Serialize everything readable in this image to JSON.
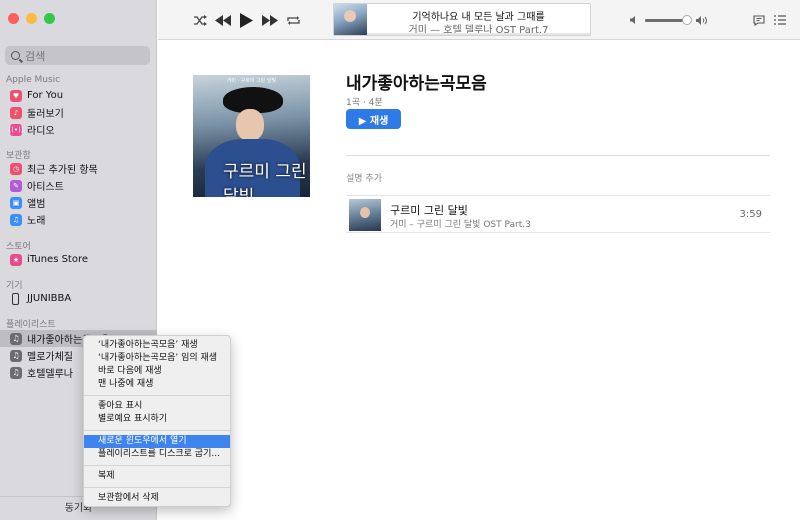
{
  "window": {
    "traffic_lights": {
      "close": "#fc605c",
      "minimize": "#fdbc40",
      "zoom": "#34c84a"
    }
  },
  "sidebar": {
    "search_placeholder": "검색",
    "sections": [
      {
        "title": "Apple Music",
        "items": [
          {
            "label": "For You",
            "icon": "heart-icon",
            "color": "#f0506e"
          },
          {
            "label": "둘러보기",
            "icon": "music-note-icon",
            "color": "#f0506e"
          },
          {
            "label": "라디오",
            "icon": "radio-icon",
            "color": "#e94b8f"
          }
        ]
      },
      {
        "title": "보관함",
        "items": [
          {
            "label": "최근 추가된 항목",
            "icon": "clock-icon",
            "color": "#f0506e"
          },
          {
            "label": "아티스트",
            "icon": "microphone-icon",
            "color": "#b35bd9"
          },
          {
            "label": "앨범",
            "icon": "album-icon",
            "color": "#3b8ff5"
          },
          {
            "label": "노래",
            "icon": "note-icon",
            "color": "#3b8ff5"
          }
        ]
      },
      {
        "title": "스토어",
        "items": [
          {
            "label": "iTunes Store",
            "icon": "star-icon",
            "color": "#e94b8f"
          }
        ]
      },
      {
        "title": "기기",
        "items": [
          {
            "label": "JJUNIBBA",
            "icon": "phone-icon",
            "color": "#333333"
          }
        ]
      },
      {
        "title": "플레이리스트",
        "items": [
          {
            "label": "내가좋아하는곡모음",
            "icon": "playlist-icon",
            "color": "#6b6b70",
            "selected": true
          },
          {
            "label": "멜로가체질",
            "icon": "playlist-icon",
            "color": "#6b6b70"
          },
          {
            "label": "호텔델루나",
            "icon": "playlist-icon",
            "color": "#6b6b70"
          }
        ]
      }
    ],
    "bottom_label": "동기화"
  },
  "player": {
    "now_playing_title": "기억하나요 내 모든 날과 그때를",
    "now_playing_artist": "거미 — 호텔 델루나 OST Part.7",
    "volume": 0.85
  },
  "playlist": {
    "title": "내가좋아하는곡모음",
    "meta": "1곡 · 4분",
    "play_label": "▶ 재생",
    "add_description": "설명 추가",
    "cover": {
      "top_text": "거미 · 구르미 그린 달빛",
      "title_text": "구르미 그린 달빛"
    },
    "tracks": [
      {
        "name": "구르미 그린 달빛",
        "subtitle": "거미 – 구르미 그린 달빛 OST Part.3",
        "duration": "3:59"
      }
    ]
  },
  "context_menu": {
    "groups": [
      [
        "‘내가좋아하는곡모음’ 재생",
        "‘내가좋아하는곡모음’ 임의 재생",
        "바로 다음에 재생",
        "맨 나중에 재생"
      ],
      [
        "좋아요 표시",
        "별로예요 표시하기"
      ],
      [
        "새로운 윈도우에서 열기",
        "플레이리스트를 디스크로 굽기..."
      ],
      [
        "복제"
      ],
      [
        "보관함에서 삭제"
      ]
    ],
    "highlighted": "새로운 윈도우에서 열기"
  }
}
